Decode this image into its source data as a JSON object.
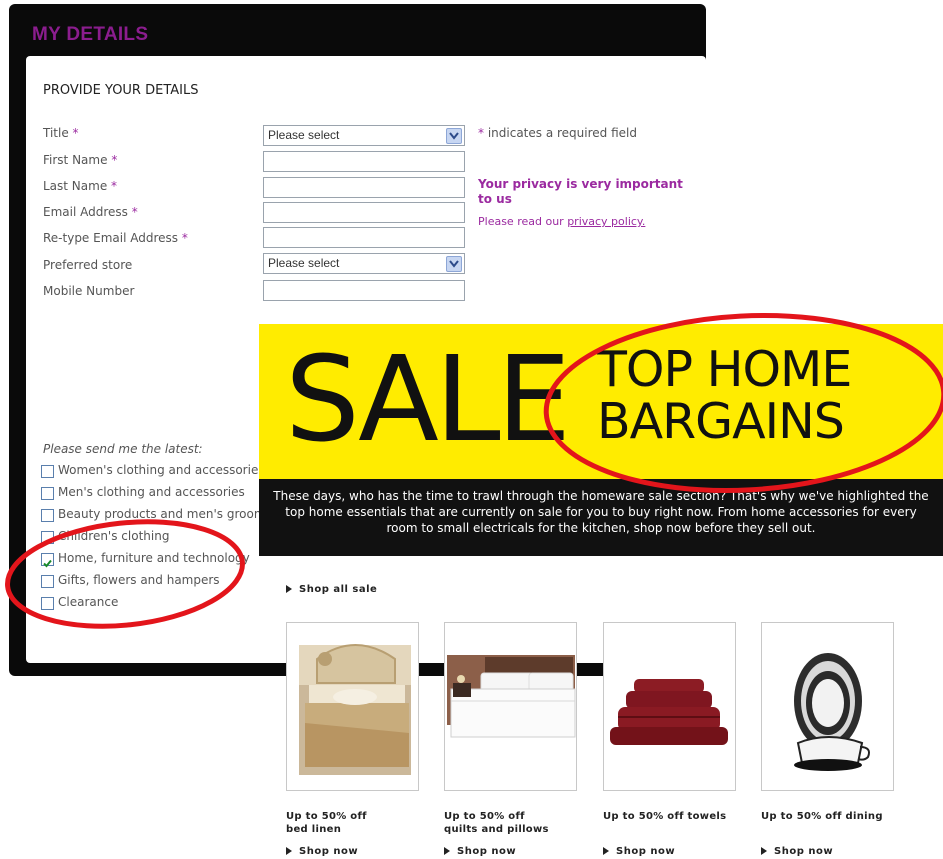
{
  "form": {
    "panel_title": "MY DETAILS",
    "section_title": "PROVIDE YOUR DETAILS",
    "required_marker": "*",
    "fields": {
      "title": {
        "label": "Title",
        "value": "Please select"
      },
      "first_name": {
        "label": "First Name",
        "value": ""
      },
      "last_name": {
        "label": "Last Name",
        "value": ""
      },
      "email": {
        "label": "Email Address",
        "value": ""
      },
      "retype_email": {
        "label": "Re-type Email Address",
        "value": ""
      },
      "preferred_store": {
        "label": "Preferred store",
        "value": "Please select"
      },
      "mobile": {
        "label": "Mobile Number",
        "value": ""
      }
    },
    "required_note": "indicates a required field",
    "privacy_heading": "Your privacy is very important to us",
    "privacy_text": "Please read our",
    "privacy_link": "privacy policy.",
    "latest_heading": "Please send me the latest:",
    "checkboxes": [
      {
        "label": "Women's clothing and accessories",
        "checked": false
      },
      {
        "label": "Men's clothing and accessories",
        "checked": false
      },
      {
        "label": "Beauty products and men's grooming",
        "checked": false
      },
      {
        "label": "Children's clothing",
        "checked": false
      },
      {
        "label": "Home, furniture and technology",
        "checked": true
      },
      {
        "label": "Gifts, flowers and hampers",
        "checked": false
      },
      {
        "label": "Clearance",
        "checked": false
      }
    ]
  },
  "banner": {
    "sale": "SALE",
    "top_home_line1": "TOP HOME",
    "top_home_line2": "BARGAINS",
    "text": "These days, who has the time to trawl through the homeware sale section? That's why we've highlighted the top home essentials that are currently on sale for you to buy right now. From home accessories for every room to small electricals for the kitchen, shop now before they sell out."
  },
  "shop_all": "Shop all sale",
  "products": [
    {
      "caption_line1": "Up to 50% off",
      "caption_line2": "bed linen",
      "link": "Shop now"
    },
    {
      "caption_line1": "Up to 50% off",
      "caption_line2": "quilts and pillows",
      "link": "Shop now"
    },
    {
      "caption_line1": "Up to 50% off towels",
      "caption_line2": "",
      "link": "Shop now"
    },
    {
      "caption_line1": "Up to 50% off dining",
      "caption_line2": "",
      "link": "Shop now"
    }
  ],
  "colors": {
    "brand_purple": "#8b1d8e",
    "banner_yellow": "#ffec00",
    "annotation_red": "#e3151b"
  }
}
